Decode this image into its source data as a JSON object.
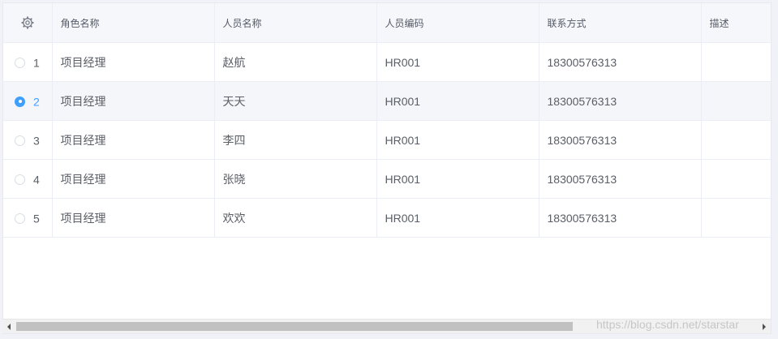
{
  "table": {
    "settings_icon": "gear-icon",
    "columns": [
      "角色名称",
      "人员名称",
      "人员编码",
      "联系方式",
      "描述"
    ],
    "rows": [
      {
        "index": "1",
        "selected": false,
        "role": "项目经理",
        "name": "赵航",
        "code": "HR001",
        "phone": "18300576313",
        "desc": ""
      },
      {
        "index": "2",
        "selected": true,
        "role": "项目经理",
        "name": "天天",
        "code": "HR001",
        "phone": "18300576313",
        "desc": ""
      },
      {
        "index": "3",
        "selected": false,
        "role": "项目经理",
        "name": "李四",
        "code": "HR001",
        "phone": "18300576313",
        "desc": ""
      },
      {
        "index": "4",
        "selected": false,
        "role": "项目经理",
        "name": "张晓",
        "code": "HR001",
        "phone": "18300576313",
        "desc": ""
      },
      {
        "index": "5",
        "selected": false,
        "role": "项目经理",
        "name": "欢欢",
        "code": "HR001",
        "phone": "18300576313",
        "desc": ""
      }
    ]
  },
  "watermark": "https://blog.csdn.net/starstar",
  "colors": {
    "accent": "#409eff",
    "header_bg": "#f6f7fa",
    "selected_row_bg": "#f5f6f9"
  }
}
